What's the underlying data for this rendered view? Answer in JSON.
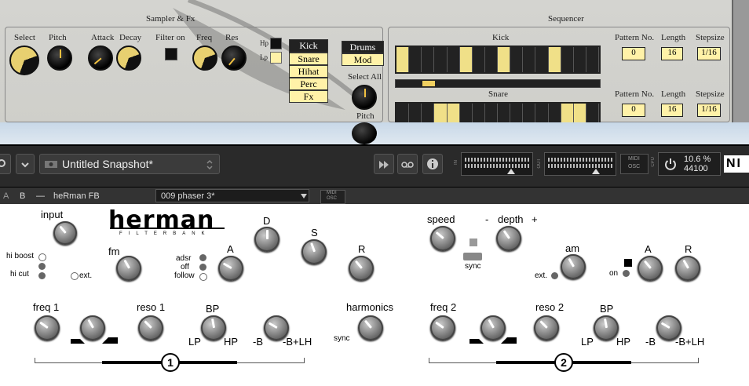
{
  "sampler": {
    "section_title": "Sampler & Fx",
    "sequencer_title": "Sequencer",
    "knobs": [
      "Select",
      "Pitch",
      "Attack",
      "Decay",
      "Filter on",
      "Freq",
      "Res"
    ],
    "hp_label": "Hp",
    "lp_label": "Lp",
    "drums": [
      "Kick",
      "Snare",
      "Hihat",
      "Perc",
      "Fx"
    ],
    "mode_buttons": [
      "Drums",
      "Mod"
    ],
    "select_all_label": "Select All",
    "pitch_label": "Pitch",
    "tracks": [
      {
        "name": "Kick",
        "steps": [
          1,
          0,
          0,
          0,
          0,
          1,
          0,
          0,
          1,
          0,
          0,
          0,
          1,
          0,
          0,
          0
        ],
        "pattern_label": "Pattern No.",
        "pattern": "0",
        "length_label": "Length",
        "length": "16",
        "stepsize_label": "Stepsize",
        "stepsize": "1/16"
      },
      {
        "name": "Snare",
        "steps": [
          0,
          0,
          0,
          1,
          1,
          0,
          0,
          0,
          0,
          0,
          0,
          0,
          0,
          1,
          1,
          0
        ],
        "pattern_label": "Pattern No.",
        "pattern": "0",
        "length_label": "Length",
        "length": "16",
        "stepsize_label": "Stepsize",
        "stepsize": "1/16"
      }
    ]
  },
  "toolbar": {
    "snapshot_name": "Untitled Snapshot*",
    "in_label": "IN",
    "out_label": "OUT",
    "midi_label": "MIDI",
    "osc_label": "OSC",
    "cpu_label": "CPU",
    "cpu_value": "10.6 %",
    "sample_rate": "44100",
    "ni_logo": "NI"
  },
  "instrument": {
    "a_label": "A",
    "b_label": "B",
    "minus_label": "—",
    "name": "heRman FB",
    "preset": "009   phaser 3*",
    "midi_label": "MIDI",
    "osc_label": "OSC"
  },
  "herman": {
    "logo_main": "herman",
    "logo_sub": "FILTERBANK",
    "input": "input",
    "hi_boost": "hi boost",
    "hi_cut": "hi cut",
    "ext": "ext.",
    "fm": "fm",
    "adsr": "adsr",
    "off": "off",
    "follow": "follow",
    "A": "A",
    "D": "D",
    "S": "S",
    "R": "R",
    "speed": "speed",
    "depth_minus": "-",
    "depth": "depth",
    "depth_plus": "+",
    "sync": "sync",
    "am": "am",
    "am_ext": "ext.",
    "on": "on",
    "A2": "A",
    "R2": "R",
    "freq1": "freq 1",
    "reso1": "reso 1",
    "bp1": "BP",
    "lp1": "LP",
    "hp1": "HP",
    "b1": "-B",
    "blh1": "-B+LH",
    "harmonics": "harmonics",
    "harm_sync": "sync",
    "freq2": "freq 2",
    "reso2": "reso 2",
    "bp2": "BP",
    "lp2": "LP",
    "hp2": "HP",
    "b2": "-B",
    "blh2": "-B+LH",
    "band1": "1",
    "band2": "2"
  }
}
